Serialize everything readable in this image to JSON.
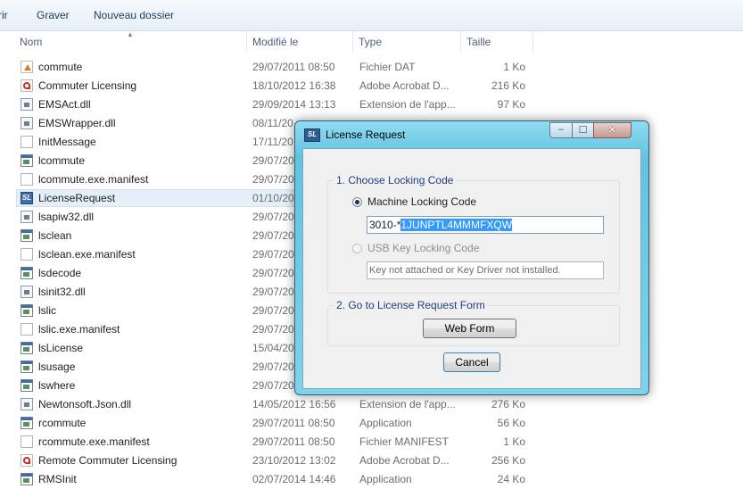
{
  "toolbar": {
    "items": [
      "rir",
      "Graver",
      "Nouveau dossier"
    ]
  },
  "columns": {
    "name": "Nom",
    "modified": "Modifié le",
    "type": "Type",
    "size": "Taille"
  },
  "files": [
    {
      "name": "commute",
      "date": "29/07/2011 08:50",
      "type": "Fichier DAT",
      "size": "1 Ko",
      "icon": "dat-file-icon"
    },
    {
      "name": "Commuter Licensing",
      "date": "18/10/2012 16:38",
      "type": "Adobe Acrobat D...",
      "size": "216 Ko",
      "icon": "pdf-file-icon"
    },
    {
      "name": "EMSAct.dll",
      "date": "29/09/2014 13:13",
      "type": "Extension de l'app...",
      "size": "97 Ko",
      "icon": "dll-file-icon"
    },
    {
      "name": "EMSWrapper.dll",
      "date": "08/11/20",
      "type": "",
      "size": "",
      "icon": "dll-file-icon"
    },
    {
      "name": "InitMessage",
      "date": "17/11/20",
      "type": "",
      "size": "",
      "icon": "file-icon"
    },
    {
      "name": "lcommute",
      "date": "29/07/20",
      "type": "",
      "size": "",
      "icon": "app-icon"
    },
    {
      "name": "lcommute.exe.manifest",
      "date": "29/07/20",
      "type": "",
      "size": "",
      "icon": "file-icon"
    },
    {
      "name": "LicenseRequest",
      "date": "01/10/20",
      "type": "",
      "size": "",
      "icon": "sentinel-app-icon",
      "selected": true
    },
    {
      "name": "lsapiw32.dll",
      "date": "29/07/20",
      "type": "",
      "size": "",
      "icon": "dll-file-icon"
    },
    {
      "name": "lsclean",
      "date": "29/07/20",
      "type": "",
      "size": "",
      "icon": "app-icon"
    },
    {
      "name": "lsclean.exe.manifest",
      "date": "29/07/20",
      "type": "",
      "size": "",
      "icon": "file-icon"
    },
    {
      "name": "lsdecode",
      "date": "29/07/20",
      "type": "",
      "size": "",
      "icon": "app-icon"
    },
    {
      "name": "lsinit32.dll",
      "date": "29/07/20",
      "type": "",
      "size": "",
      "icon": "dll-file-icon"
    },
    {
      "name": "lslic",
      "date": "29/07/20",
      "type": "",
      "size": "",
      "icon": "app-icon"
    },
    {
      "name": "lslic.exe.manifest",
      "date": "29/07/20",
      "type": "",
      "size": "",
      "icon": "file-icon"
    },
    {
      "name": "lsLicense",
      "date": "15/04/20",
      "type": "",
      "size": "",
      "icon": "app-icon"
    },
    {
      "name": "lsusage",
      "date": "29/07/20",
      "type": "",
      "size": "",
      "icon": "app-icon"
    },
    {
      "name": "lswhere",
      "date": "29/07/20",
      "type": "",
      "size": "",
      "icon": "app-icon"
    },
    {
      "name": "Newtonsoft.Json.dll",
      "date": "14/05/2012 16:56",
      "type": "Extension de l'app...",
      "size": "276 Ko",
      "icon": "dll-file-icon"
    },
    {
      "name": "rcommute",
      "date": "29/07/2011 08:50",
      "type": "Application",
      "size": "56 Ko",
      "icon": "app-icon"
    },
    {
      "name": "rcommute.exe.manifest",
      "date": "29/07/2011 08:50",
      "type": "Fichier MANIFEST",
      "size": "1 Ko",
      "icon": "file-icon"
    },
    {
      "name": "Remote Commuter Licensing",
      "date": "23/10/2012 13:02",
      "type": "Adobe Acrobat D...",
      "size": "256 Ko",
      "icon": "pdf-file-icon"
    },
    {
      "name": "RMSInit",
      "date": "02/07/2014 14:46",
      "type": "Application",
      "size": "24 Ko",
      "icon": "app-icon"
    }
  ],
  "dialog": {
    "title": "License Request",
    "icon": "sentinel-app-icon",
    "window_buttons": {
      "minimize": "–",
      "maximize": "☐",
      "close": "✕"
    },
    "group1": {
      "legend": "1.  Choose Locking Code",
      "machine_label": "Machine Locking Code",
      "machine_code_prefix": "3010-*",
      "machine_code_selected": "1JUNPTL4MMMFXQW",
      "usb_label": "USB Key Locking Code",
      "usb_value": "Key not attached or Key Driver not installed."
    },
    "group2": {
      "legend": "2.  Go to License Request Form",
      "web_form_button": "Web Form"
    },
    "cancel_button": "Cancel"
  }
}
